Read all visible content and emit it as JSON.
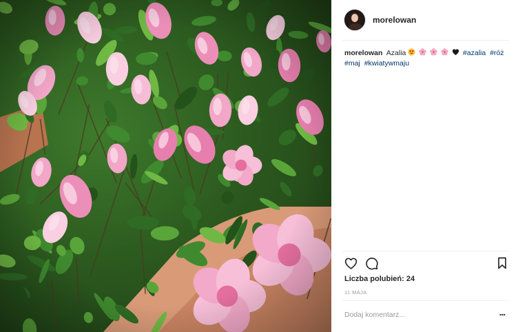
{
  "post": {
    "username": "morelowan",
    "photo_icon": "flower-photo",
    "caption": {
      "username": "morelowan",
      "text": "Azalia",
      "emojis": [
        "heart-eyes-emoji",
        "pink-blossom-emoji",
        "pink-blossom-emoji",
        "pink-blossom-emoji",
        "black-heart-emoji"
      ],
      "hashtags": [
        "#azalia",
        "#róż",
        "#maj",
        "#kwiatywmaju"
      ]
    },
    "actions": {
      "like_icon": "heart-icon",
      "comment_icon": "comment-icon",
      "save_icon": "bookmark-icon"
    },
    "likes_text": "Liczba polubień: 24",
    "date_text": "11 MAJA",
    "comment": {
      "placeholder": "Dodaj komentarz...",
      "more_label": "..."
    }
  },
  "colors": {
    "hashtag": "#003569",
    "muted": "#999999",
    "text": "#262626",
    "border": "#dbdbdb"
  }
}
